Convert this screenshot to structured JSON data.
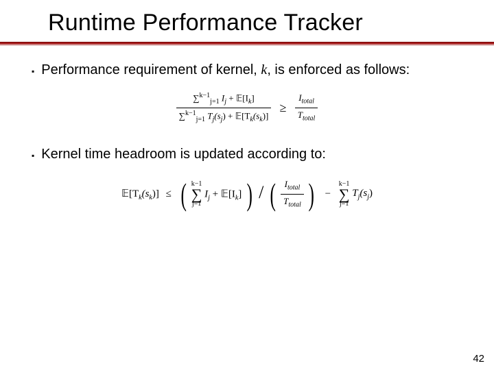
{
  "title": "Runtime Performance Tracker",
  "bullets": [
    {
      "text_prefix": "Performance requirement of kernel, ",
      "var": "k",
      "text_suffix": ", is enforced as follows:"
    },
    {
      "text": "Kernel time headroom is updated according to:"
    }
  ],
  "equations": {
    "eq1": {
      "num_left": "∑_{j=1}^{k−1} I_j + 𝔼[I_k]",
      "den_left": "∑_{j=1}^{k−1} T_j(s_j) + 𝔼[T_k(s_k)]",
      "relation": "≥",
      "num_right": "I_total",
      "den_right": "T_total"
    },
    "eq2": {
      "lhs": "𝔼[T_k(s_k)]",
      "relation": "≤",
      "group1": "( ∑_{j=1}^{k−1} I_j + 𝔼[I_k] )",
      "div_by": "( I_total / T_total )",
      "minus": "−",
      "group2": "∑_{j=1}^{k−1} T_j(s_j)"
    }
  },
  "labels": {
    "sigma_top": "k−1",
    "sigma_bot": "j=1",
    "I_j": "I",
    "I_j_sub": "j",
    "EIk": "𝔼[I",
    "EIk_sub": "k",
    "EIk_close": "]",
    "T_js": "T",
    "T_js_sub": "j",
    "T_js_arg": "(s",
    "T_js_argsub": "j",
    "T_js_close": ")",
    "ETk": "𝔼[T",
    "ETk_sub": "k",
    "ETk_arg": "(s",
    "ETk_argsub": "k",
    "ETk_close": ")]",
    "ge": "≥",
    "le": "≤",
    "Itotal": "I",
    "Itotal_sub": "total",
    "Ttotal": "T",
    "Ttotal_sub": "total",
    "slash": "/",
    "minus": "−"
  },
  "page_number": "42"
}
